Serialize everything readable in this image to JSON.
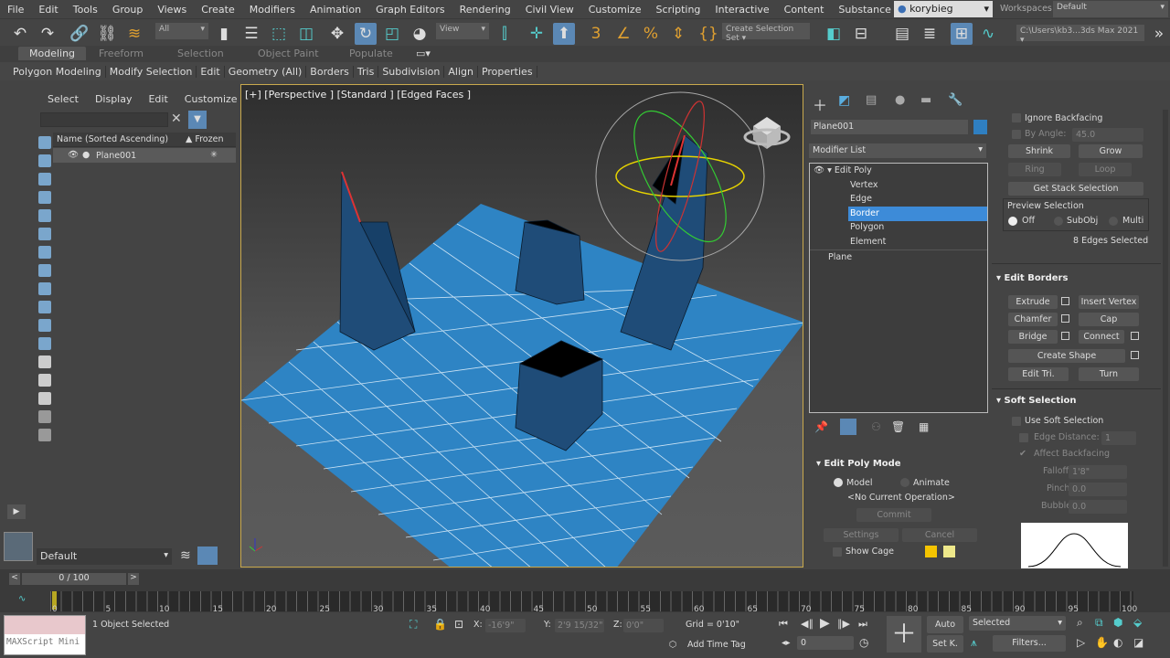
{
  "menu": [
    "File",
    "Edit",
    "Tools",
    "Group",
    "Views",
    "Create",
    "Modifiers",
    "Animation",
    "Graph Editors",
    "Rendering",
    "Civil View",
    "Customize",
    "Scripting",
    "Interactive",
    "Content",
    "Substance"
  ],
  "user": "korybieg",
  "workspaces_label": "Workspaces:",
  "workspace": "Default",
  "toolbar": {
    "filter": "All",
    "view": "View",
    "selection_set": "Create Selection Set",
    "path": "C:\\Users\\kb3...3ds Max 2021"
  },
  "ribbon_tabs": [
    "Modeling",
    "Freeform",
    "Selection",
    "Object Paint",
    "Populate"
  ],
  "ribbon_items": [
    "Polygon Modeling",
    "Modify Selection",
    "Edit",
    "Geometry (All)",
    "Borders",
    "Tris",
    "Subdivision",
    "Align",
    "Properties"
  ],
  "explorer": {
    "menu": [
      "Select",
      "Display",
      "Edit",
      "Customize"
    ],
    "col_name": "Name (Sorted Ascending)",
    "col_frozen": "▲ Frozen",
    "object": "Plane001",
    "layer": "Default"
  },
  "viewport": {
    "label": "[+] [Perspective ] [Standard ] [Edged Faces ]"
  },
  "cmd": {
    "object_name": "Plane001",
    "object_color": "#2f7fc1",
    "modifier_list": "Modifier List",
    "stack": [
      "Edit Poly",
      "Vertex",
      "Edge",
      "Border",
      "Polygon",
      "Element",
      "Plane"
    ],
    "mode_title": "Edit Poly Mode",
    "model": "Model",
    "animate": "Animate",
    "no_op": "<No Current Operation>",
    "commit": "Commit",
    "settings": "Settings",
    "cancel": "Cancel",
    "show_cage": "Show Cage"
  },
  "selection": {
    "ignore_backfacing": "Ignore Backfacing",
    "by_angle": "By Angle:",
    "angle": "45.0",
    "shrink": "Shrink",
    "grow": "Grow",
    "ring": "Ring",
    "loop": "Loop",
    "get_stack": "Get Stack Selection",
    "preview": "Preview Selection",
    "off": "Off",
    "subobj": "SubObj",
    "multi": "Multi",
    "count": "8 Edges Selected"
  },
  "edit_borders": {
    "title": "Edit Borders",
    "extrude": "Extrude",
    "insert_vertex": "Insert Vertex",
    "chamfer": "Chamfer",
    "cap": "Cap",
    "bridge": "Bridge",
    "connect": "Connect",
    "create_shape": "Create Shape",
    "edit_tri": "Edit Tri.",
    "turn": "Turn"
  },
  "soft": {
    "title": "Soft Selection",
    "use": "Use Soft Selection",
    "edge_distance": "Edge Distance:",
    "edge_val": "1",
    "affect_back": "Affect Backfacing",
    "falloff": "Falloff:",
    "falloff_val": "1'8\"",
    "pinch": "Pinch:",
    "pinch_val": "0.0",
    "bubble": "Bubble:",
    "bubble_val": "0.0"
  },
  "timeline": {
    "frame": "0 / 100",
    "ticks": [
      "0",
      "5",
      "10",
      "15",
      "20",
      "25",
      "30",
      "35",
      "40",
      "45",
      "50",
      "55",
      "60",
      "65",
      "70",
      "75",
      "80",
      "85",
      "90",
      "95",
      "100"
    ]
  },
  "status": {
    "maxscript": "MAXScript Mini",
    "selected": "1 Object Selected",
    "x_label": "X:",
    "x": "-16'9\"",
    "y_label": "Y:",
    "y": "2'9 15/32\"",
    "z_label": "Z:",
    "z": "0'0\"",
    "grid": "Grid = 0'10\"",
    "add_time_tag": "Add Time Tag",
    "auto": "Auto",
    "setk": "Set K.",
    "key_filter": "Selected",
    "filters": "Filters...",
    "frame_val": "0"
  }
}
